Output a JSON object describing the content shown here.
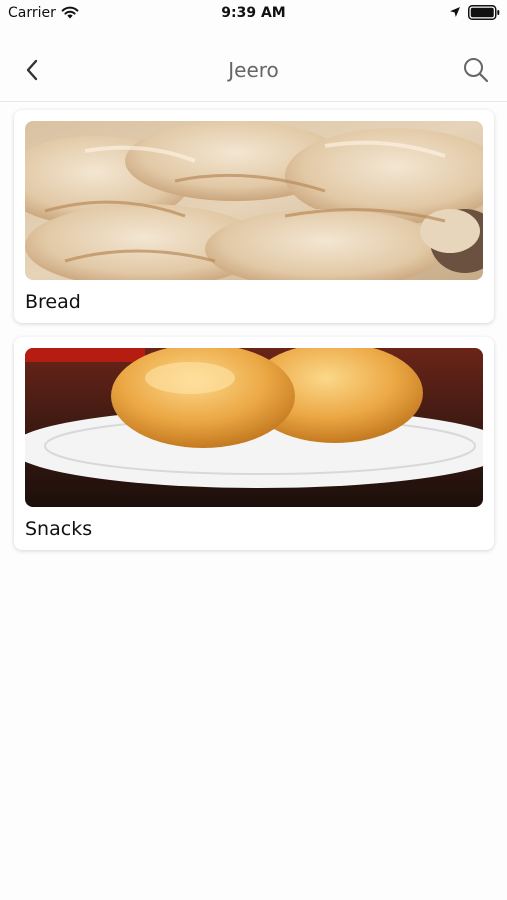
{
  "status_bar": {
    "carrier": "Carrier",
    "time": "9:39 AM",
    "icons": [
      "wifi-icon",
      "location-arrow-icon",
      "battery-icon"
    ]
  },
  "nav": {
    "title": "Jeero",
    "back_icon": "chevron-left-icon",
    "search_icon": "search-icon"
  },
  "categories": [
    {
      "label": "Bread",
      "image": "bread-photo"
    },
    {
      "label": "Snacks",
      "image": "donuts-photo"
    }
  ],
  "colors": {
    "background": "#fdfdfd",
    "title_text": "#666666",
    "label_text": "#111111",
    "card": "#ffffff"
  }
}
